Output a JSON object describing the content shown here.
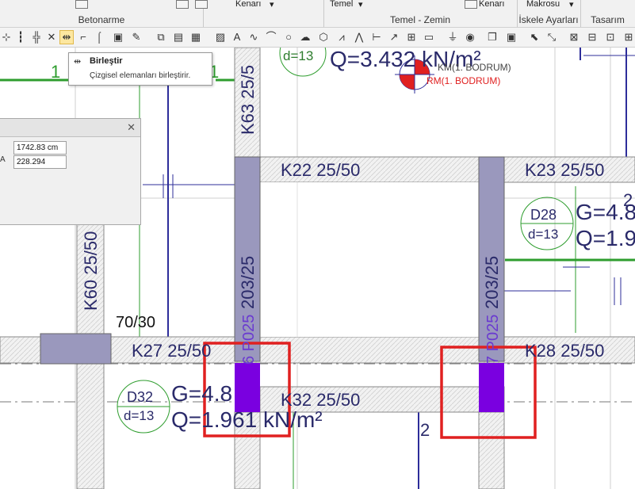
{
  "ribbon": {
    "groups": [
      {
        "label": "Betonarme"
      },
      {
        "label": "Temel - Zemin"
      },
      {
        "label": "İskele Ayarları"
      },
      {
        "label": "Tasarım"
      }
    ],
    "button_texts": {
      "kenari_1": "Kenarı",
      "temel": "Temel",
      "kenari_2": "Kenarı",
      "makrosu": "Makrosu"
    }
  },
  "tooltip": {
    "title": "Birleştir",
    "description": "Çizgisel elemanları birleştirir."
  },
  "coord_panel": {
    "field1_value": "1742.83 cm",
    "field2_label": "A",
    "field2_value": "228.294"
  },
  "drawing": {
    "beams": {
      "k22": "K22 25/50",
      "k23": "K23 25/50",
      "k27": "K27 25/50",
      "k28": "K28 25/50",
      "k32": "K32 25/50",
      "k63": "K63 25/5",
      "k60": "K60 25/50",
      "col_left": "203/25",
      "col_right": "203/25"
    },
    "slabs": {
      "d28_name": "D28",
      "d28_thickness": "d=13",
      "d28_g": "G=4.8",
      "d28_q": "Q=1.9",
      "d32_name": "D32",
      "d32_thickness": "d=13",
      "d32_g": "G=4.8",
      "d32_q": "Q=1.961 kN/m²",
      "top_thickness": "d=13",
      "top_q": "Q=3.432 kN/m²"
    },
    "labels": {
      "km": "KM(1. BODRUM)",
      "rm": "RM(1. BODRUM)",
      "dim_70_30": "70/30",
      "num_1a": "1",
      "num_1b": "1",
      "num_2a": "2",
      "num_2b": "2",
      "pz_left": "6 P025",
      "pz_right": "7 P025"
    }
  }
}
